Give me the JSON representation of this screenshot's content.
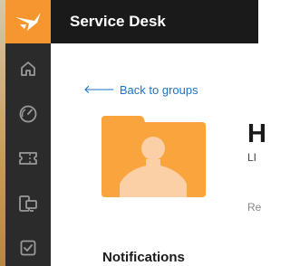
{
  "app": {
    "title": "Service Desk",
    "brand_color": "#f5962e"
  },
  "sidebar": {
    "items": [
      {
        "name": "home-icon"
      },
      {
        "name": "dashboard-gauge-icon"
      },
      {
        "name": "ticket-icon"
      },
      {
        "name": "devices-icon"
      },
      {
        "name": "checkbox-tasks-icon"
      }
    ]
  },
  "nav": {
    "back_label": "Back to groups",
    "back_arrow": "🡐"
  },
  "group": {
    "heading_partial": "H",
    "subtitle_partial": "LI",
    "meta_partial": "Re",
    "avatar_color": "#f9a43c"
  },
  "sections": {
    "notifications_title": "Notifications"
  }
}
